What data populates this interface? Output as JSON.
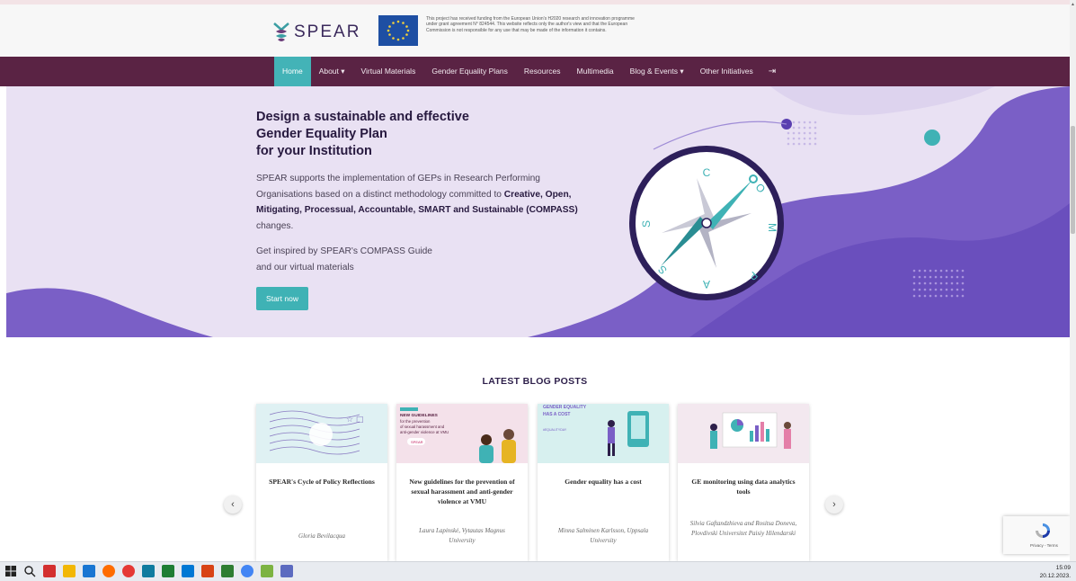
{
  "header": {
    "logo_text": "SPEAR",
    "eu_note": "This project has received funding from the European Union's H2020 research and innovation programme under grant agreement N° 824544. This website reflects only the author's view and that the European Commission is not responsible for any use that may be made of the information it contains."
  },
  "nav": {
    "items": [
      {
        "label": "Home",
        "active": true
      },
      {
        "label": "About ▾"
      },
      {
        "label": "Virtual Materials"
      },
      {
        "label": "Gender Equality Plans"
      },
      {
        "label": "Resources"
      },
      {
        "label": "Multimedia"
      },
      {
        "label": "Blog & Events ▾"
      },
      {
        "label": "Other Initiatives"
      }
    ],
    "login_icon": "login-icon"
  },
  "hero": {
    "title_line1": "Design a sustainable and effective",
    "title_line2": "Gender Equality Plan",
    "title_line3": "for your Institution",
    "desc_part1": "SPEAR supports the implementation of GEPs in Research Performing Organisations based on a distinct methodology committed to ",
    "desc_bold": "Creative, Open, Mitigating, Processual, Accountable, SMART and Sustainable (COMPASS)",
    "desc_part2": " changes.",
    "inspire_line1": "Get inspired by SPEAR's COMPASS Guide",
    "inspire_line2": "and our virtual materials",
    "button": "Start now",
    "compass_letters": {
      "c": "C",
      "o": "O",
      "m": "M",
      "p": "P",
      "a": "A",
      "s1": "S",
      "s2": "S"
    }
  },
  "blog": {
    "section_title": "LATEST BLOG POSTS",
    "prev": "‹",
    "next": "›",
    "posts": [
      {
        "title": "SPEAR's Cycle of Policy Reflections",
        "author": "Gloria Bevilacqua"
      },
      {
        "title": "New guidelines for the prevention of sexual harassment and anti-gender violence at VMU",
        "author": "Laura Lapinskė, Vytautas Magnus University",
        "img_text1": "NEW GUIDELINES",
        "img_text2": "for the prevention",
        "img_text3": "of sexual harassment and",
        "img_text4": "anti-gender violence at VMU",
        "img_badge": "SPEAR"
      },
      {
        "title": "Gender equality has a cost",
        "author": "Minna Salminen Karlsson, Uppsala University",
        "img_text1": "GENDER EQUALITY",
        "img_text2": "HAS A COST",
        "img_text3": "#EQUALITYDAY"
      },
      {
        "title": "GE monitoring using data analytics tools",
        "author": "Silvia Gaftandzhieva and Rositsa Doneva, Plovdivski Universitet Paisiy Hilendarski"
      }
    ]
  },
  "recaptcha": {
    "text": "Privacy - Terms"
  },
  "taskbar": {
    "time": "15:09",
    "date": "20.12.2023."
  }
}
